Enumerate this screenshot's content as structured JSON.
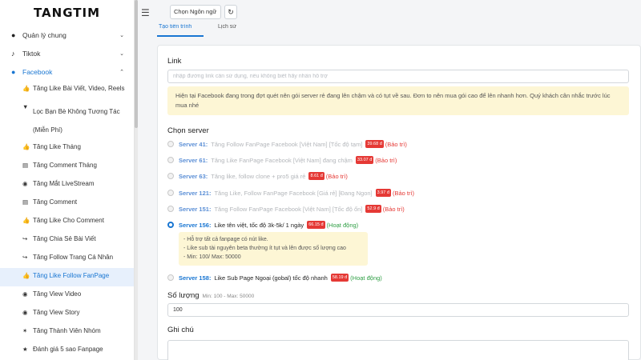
{
  "brand": "TANGTIM",
  "sidebar": {
    "groups": [
      {
        "icon": "●",
        "label": "Quản lý chung",
        "chevron": "⌄"
      },
      {
        "icon": "♪",
        "label": "Tiktok",
        "chevron": "⌄"
      },
      {
        "icon": "●",
        "label": "Facebook",
        "chevron": "⌃"
      }
    ],
    "items": [
      {
        "icon": "👍",
        "label": "Tăng Like Bài Viết, Video, Reels"
      },
      {
        "icon": "▼",
        "label": "Lọc Bạn Bè Không Tương Tác (Miễn Phí)"
      },
      {
        "icon": "👍",
        "label": "Tăng Like Tháng"
      },
      {
        "icon": "▤",
        "label": "Tăng Comment Tháng"
      },
      {
        "icon": "◉",
        "label": "Tăng Mắt LiveStream"
      },
      {
        "icon": "▤",
        "label": "Tăng Comment"
      },
      {
        "icon": "👍",
        "label": "Tăng Like Cho Comment"
      },
      {
        "icon": "↪",
        "label": "Tăng Chia Sẻ Bài Viết"
      },
      {
        "icon": "↪",
        "label": "Tăng Follow Trang Cá Nhân"
      },
      {
        "icon": "👍",
        "label": "Tăng Like Follow FanPage"
      },
      {
        "icon": "◉",
        "label": "Tăng View Video"
      },
      {
        "icon": "◉",
        "label": "Tăng View Story"
      },
      {
        "icon": "✶",
        "label": "Tăng Thành Viên Nhóm"
      },
      {
        "icon": "★",
        "label": "Đánh giá 5 sao Fanpage"
      }
    ]
  },
  "topbar": {
    "menu_icon": "☰",
    "language_select": "Chọn Ngôn ngữ",
    "refresh_icon": "↻"
  },
  "tabs": {
    "tab1": "Tạo tiến trình",
    "tab2": "Lịch sử"
  },
  "form": {
    "link_label": "Link",
    "link_placeholder": "nhập đường link cần sử dụng, nếu không biết hãy nhấn hỗ trợ",
    "notice": "Hiện tại Facebook đang trong đợt quét nên gói server rẻ đang lên chậm và có tụt về sau. Đơn to nên mua gói cao để lên nhanh hơn. Quý khách cân nhắc trước lúc mua nhé",
    "server_label": "Chọn server",
    "servers": [
      {
        "name": "Server 41:",
        "desc": "Tăng Follow FanPage Facebook [Việt Nam] [Tốc độ tạm]",
        "price": "39.68 đ",
        "status": "(Bảo trì)"
      },
      {
        "name": "Server 61:",
        "desc": "Tăng Like FanPage Facebook [Việt Nam] đang chậm",
        "price": "33.07 đ",
        "status": "(Bảo trì)"
      },
      {
        "name": "Server 63:",
        "desc": "Tăng like, follow clone + pro5 giá rẻ",
        "price": "8.61 đ",
        "status": "(Bảo trì)"
      },
      {
        "name": "Server 121:",
        "desc": "Tăng Like, Follow FanPage Facebook [Giá rẻ] [Đang Ngon]",
        "price": "3.97 đ",
        "status": "(Bảo trì)"
      },
      {
        "name": "Server 151:",
        "desc": "Tăng Follow FanPage Facebook [Việt Nam] [Tốc độ ổn]",
        "price": "52.9 đ",
        "status": "(Bảo trì)"
      },
      {
        "name": "Server 156:",
        "desc": "Like tên việt, tốc độ 3k-5k/ 1 ngày",
        "price": "66.15 đ",
        "status": "(Hoạt động)"
      },
      {
        "name": "Server 158:",
        "desc": "Like Sub Page Ngoại (gobal) tốc độ nhanh",
        "price": "58.19 đ",
        "status": "(Hoạt động)"
      }
    ],
    "server_note": [
      "- Hỗ trợ tất cả fanpage có nút like.",
      "- Like sub tài nguyên beta thường ít tụt và lên được số lượng cao",
      "- Min: 100/ Max: 50000"
    ],
    "quantity_label": "Số lượng",
    "quantity_hint": "Min: 100 - Max: 50000",
    "quantity_value": "100",
    "note_label": "Ghi chú"
  },
  "colors": {
    "accent": "#1976d2",
    "danger": "#e53935",
    "success": "#2e9e44",
    "notice_bg": "#fdf6d5"
  }
}
